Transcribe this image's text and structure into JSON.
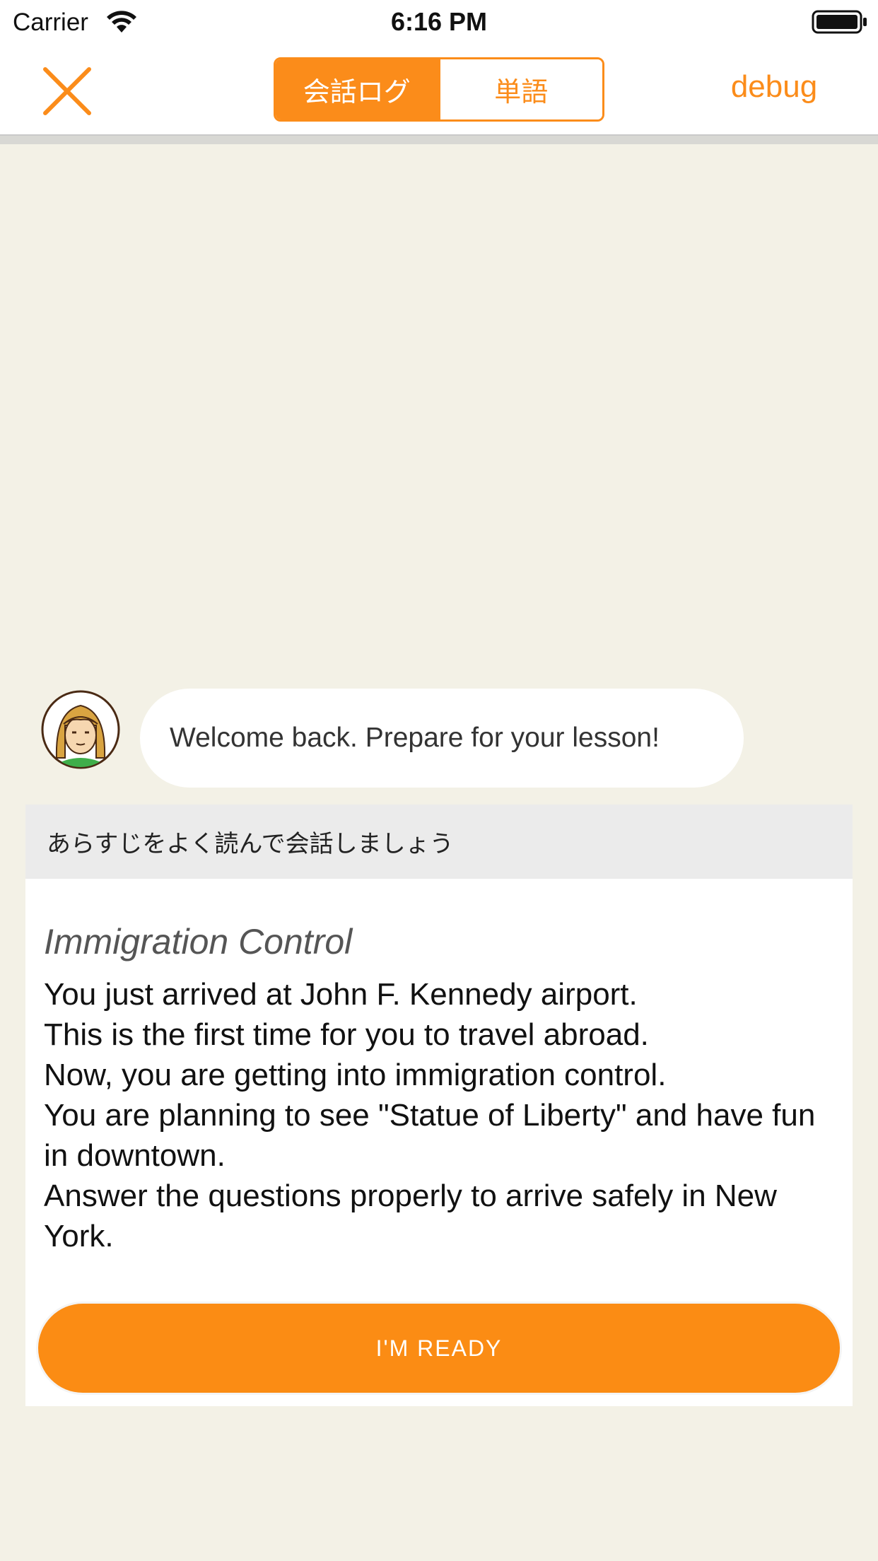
{
  "status_bar": {
    "carrier": "Carrier",
    "time": "6:16 PM",
    "wifi_icon": "wifi-icon",
    "battery_icon": "battery-full-icon"
  },
  "nav": {
    "close_icon": "close-x-icon",
    "tabs": [
      {
        "label": "会話ログ",
        "active": true
      },
      {
        "label": "単語",
        "active": false
      }
    ],
    "debug_label": "debug"
  },
  "chat": {
    "avatar": "avatar-icon",
    "message": "Welcome back. Prepare for your lesson!"
  },
  "card": {
    "header": "あらすじをよく読んで会話しましょう",
    "title": "Immigration Control",
    "body": "You just arrived at John F. Kennedy airport.\nThis is the first time for you to travel abroad.\nNow, you are getting into immigration control.\nYou are planning to see \"Statue of Liberty\" and have fun in downtown.\nAnswer the questions properly to arrive safely in New York.",
    "button_label": "I'M READY"
  },
  "colors": {
    "accent": "#fb8c1a",
    "background": "#f3f1e6",
    "card_header": "#ebebeb"
  }
}
